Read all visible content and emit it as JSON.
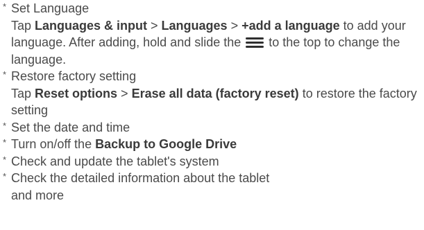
{
  "bullet": "*",
  "items": [
    {
      "heading": "Set Language",
      "detail": {
        "t1": "Tap ",
        "b1": "Languages & input",
        "t2": " > ",
        "b2": "Languages",
        "t3": " > ",
        "b3": "+add a language",
        "t4": " to add your language. After adding, hold and slide the ",
        "icon": "menu-icon",
        "t5": " to the top to change the language."
      }
    },
    {
      "heading": "Restore factory setting",
      "detail": {
        "t1": "Tap ",
        "b1": "Reset options",
        "t2": " > ",
        "b2": "Erase all data (factory reset)",
        "t3": " to restore the factory setting"
      }
    },
    {
      "heading": "Set the date and time"
    },
    {
      "heading_t1": "Turn on/off the ",
      "heading_b1": "Backup to Google Drive"
    },
    {
      "heading": "Check and update the tablet's system"
    },
    {
      "heading": "Check the detailed information about the tablet",
      "tail": "and more"
    }
  ]
}
